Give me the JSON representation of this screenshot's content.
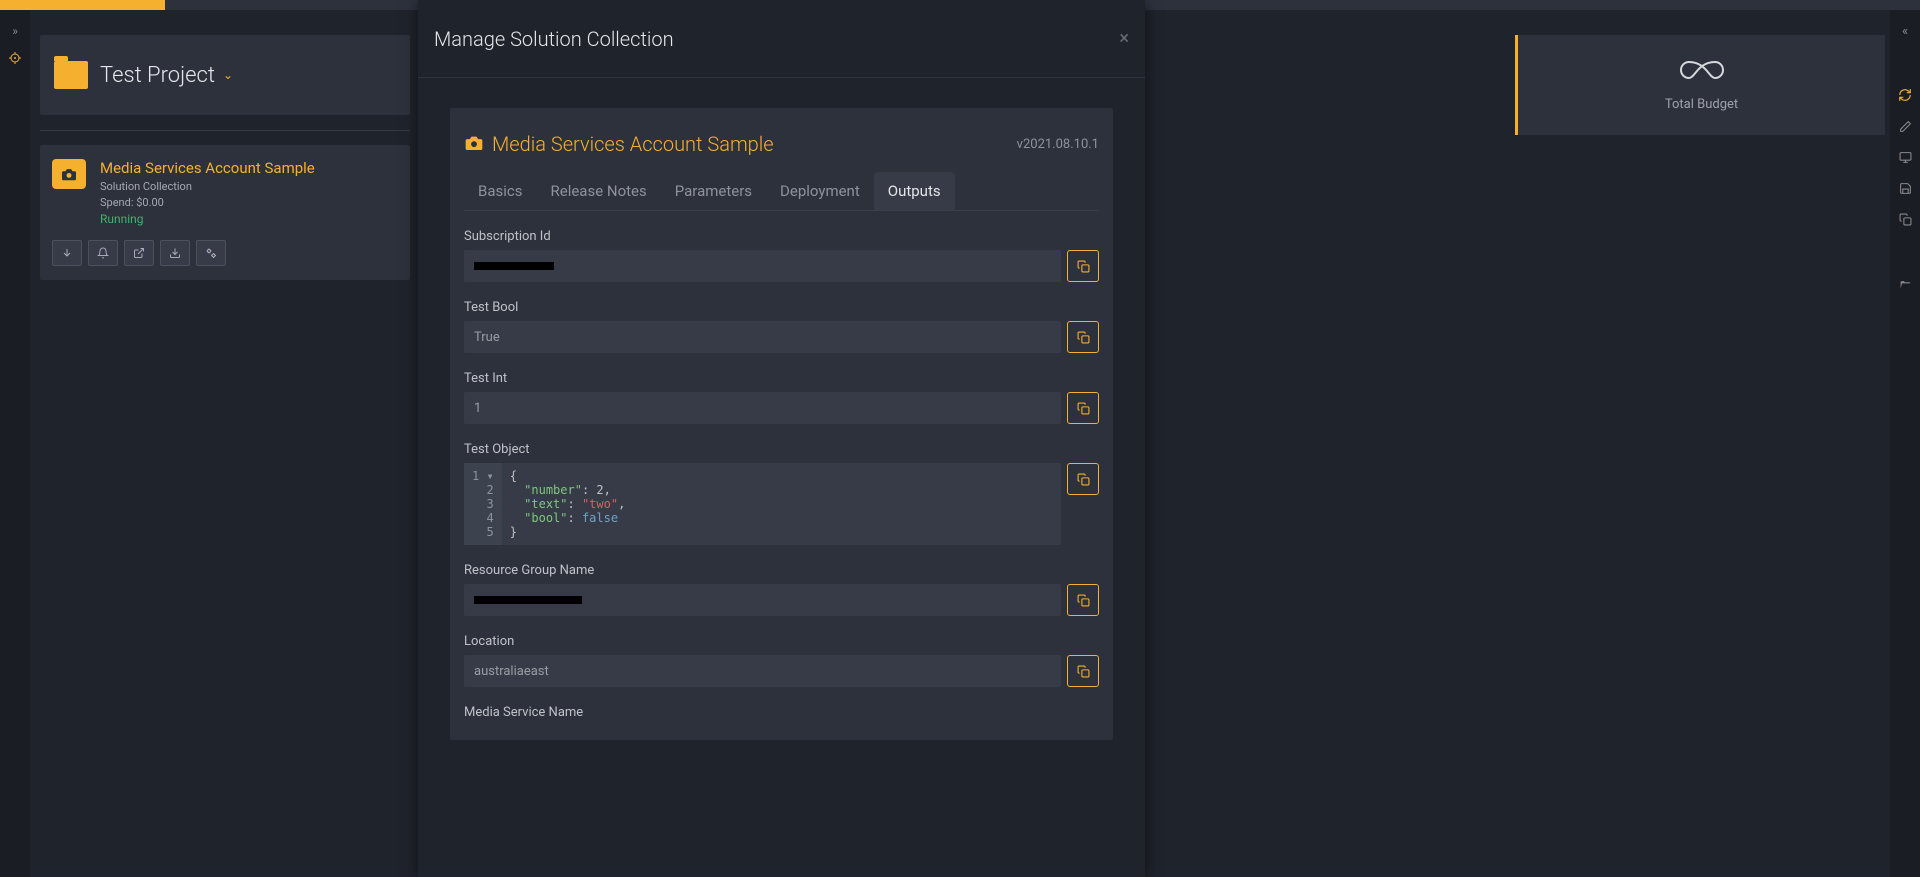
{
  "project": {
    "title": "Test Project"
  },
  "solution": {
    "title": "Media Services Account Sample",
    "subtitle": "Solution Collection",
    "spend": "Spend: $0.00",
    "status": "Running"
  },
  "budget": {
    "label": "Total Budget"
  },
  "modal": {
    "title": "Manage Solution Collection",
    "inner_title": "Media Services Account Sample",
    "version": "v2021.08.10.1",
    "tabs": {
      "basics": "Basics",
      "release_notes": "Release Notes",
      "parameters": "Parameters",
      "deployment": "Deployment",
      "outputs": "Outputs"
    },
    "outputs": {
      "subscription_id": {
        "label": "Subscription Id",
        "value": ""
      },
      "test_bool": {
        "label": "Test Bool",
        "value": "True"
      },
      "test_int": {
        "label": "Test Int",
        "value": "1"
      },
      "test_object": {
        "label": "Test Object",
        "lines": [
          "1",
          "2",
          "3",
          "4",
          "5"
        ],
        "json": {
          "number": 2,
          "text": "two",
          "bool": false
        }
      },
      "resource_group": {
        "label": "Resource Group Name",
        "value": ""
      },
      "location": {
        "label": "Location",
        "value": "australiaeast"
      },
      "media_service_name": {
        "label": "Media Service Name",
        "value": ""
      }
    }
  }
}
